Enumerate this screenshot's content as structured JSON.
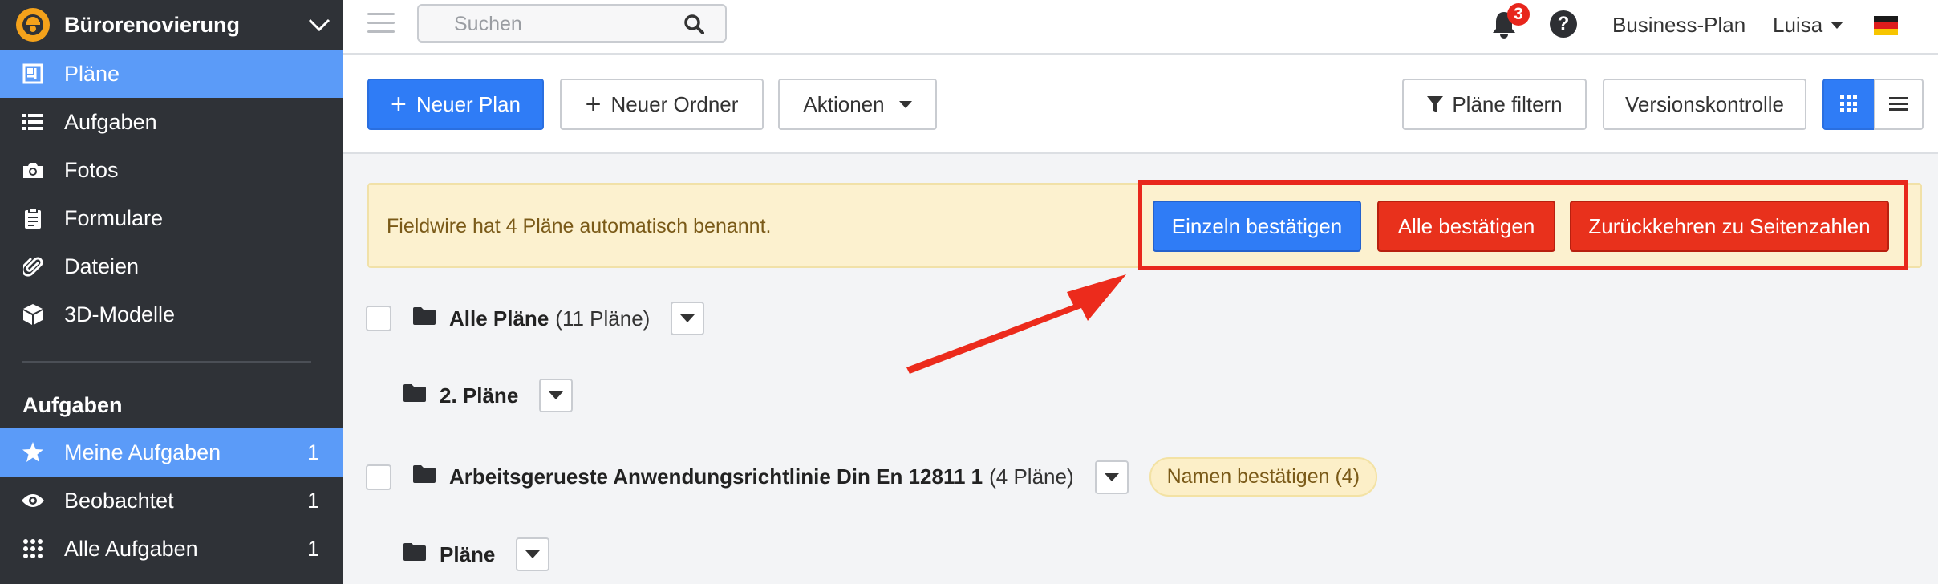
{
  "sidebar": {
    "project": "Bürorenovierung",
    "nav": [
      {
        "label": "Pläne",
        "icon": "plans-icon",
        "active": true
      },
      {
        "label": "Aufgaben",
        "icon": "list-icon"
      },
      {
        "label": "Fotos",
        "icon": "camera-icon"
      },
      {
        "label": "Formulare",
        "icon": "clipboard-icon"
      },
      {
        "label": "Dateien",
        "icon": "paperclip-icon"
      },
      {
        "label": "3D-Modelle",
        "icon": "cube-icon"
      }
    ],
    "section_title": "Aufgaben",
    "tasks": [
      {
        "label": "Meine Aufgaben",
        "count": "1",
        "icon": "star-icon",
        "active": true
      },
      {
        "label": "Beobachtet",
        "count": "1",
        "icon": "eye-icon"
      },
      {
        "label": "Alle Aufgaben",
        "count": "1",
        "icon": "grid-dots-icon"
      }
    ]
  },
  "topbar": {
    "search_placeholder": "Suchen",
    "notification_count": "3",
    "help_label": "?",
    "plan_label": "Business-Plan",
    "user_name": "Luisa"
  },
  "toolbar": {
    "new_plan": "Neuer Plan",
    "new_folder": "Neuer Ordner",
    "actions": "Aktionen",
    "filter": "Pläne filtern",
    "version_control": "Versionskontrolle"
  },
  "banner": {
    "message": "Fieldwire hat 4 Pläne automatisch benannt.",
    "confirm_single": "Einzeln bestätigen",
    "confirm_all": "Alle bestätigen",
    "revert": "Zurückkehren zu Seitenzahlen"
  },
  "tree": {
    "all_plans": "Alle Pläne",
    "all_plans_count": "(11 Pläne)",
    "folder_2": "2. Pläne",
    "folder_arb": "Arbeitsgerueste Anwendungsrichtlinie Din En 12811 1",
    "folder_arb_count": "(4 Pläne)",
    "confirm_names": "Namen bestätigen (4)",
    "folder_plans": "Pläne"
  },
  "colors": {
    "sidebar_bg": "#2f3237",
    "active_bg": "#5b9bf8",
    "primary": "#2f7cf6",
    "danger": "#e8311c",
    "banner_bg": "#fcf1cf"
  }
}
